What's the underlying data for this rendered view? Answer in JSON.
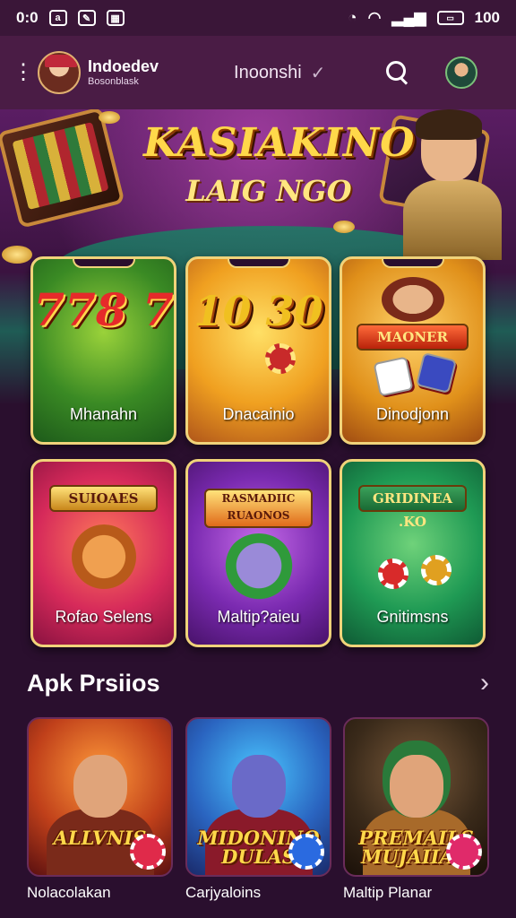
{
  "status_bar": {
    "time": "0:0",
    "left_icons": [
      "a-icon",
      "maps-icon",
      "gallery-icon"
    ],
    "left_icon_glyphs": [
      "a",
      "✎",
      "▦"
    ],
    "battery": "100"
  },
  "header": {
    "brand_title": "Indoedev",
    "brand_subtitle": "Bosonblask",
    "language": "Inoonshi"
  },
  "hero": {
    "title": "KASIAKINO",
    "subtitle": "LAIG NGO"
  },
  "games": [
    {
      "label": "Mhanahn",
      "art": "778 7"
    },
    {
      "label": "Dnacainio",
      "art": "10 30"
    },
    {
      "label": "Dinodjonn",
      "art": "MAONER"
    },
    {
      "label": "Rofao Selens",
      "art": "SUIOAES"
    },
    {
      "label": "Maltip?aieu",
      "art": "RASMADIIC RUAONOS"
    },
    {
      "label": "Gnitimsns",
      "art": "GRIDINEA .KO"
    }
  ],
  "section": {
    "title": "Apk Prsiios"
  },
  "promos": [
    {
      "art_text": "ALLVNIS",
      "caption": "Nolacolakan"
    },
    {
      "art_text": "MIDONINO DULAS",
      "caption": "Carjyaloins"
    },
    {
      "art_text": "PREMAILS MUJAIIAN",
      "caption": "Maltip Planar"
    }
  ],
  "colors": {
    "background": "#2a0f2e",
    "header": "#4a1c45",
    "card_border": "#f0d37a",
    "title_gold": "#ffd84a"
  }
}
